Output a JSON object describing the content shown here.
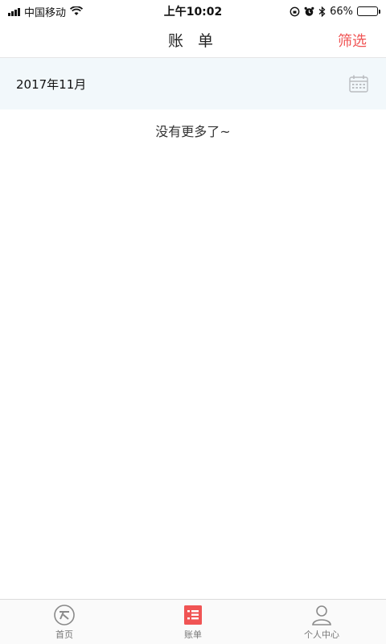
{
  "status_bar": {
    "carrier": "中国移动",
    "time": "上午10:02",
    "battery": "66%",
    "battery_level": 0.66
  },
  "nav": {
    "title": "账 单",
    "filter_label": "筛选"
  },
  "month": {
    "label": "2017年11月"
  },
  "empty_message": "没有更多了~",
  "tabs": [
    {
      "label": "首页",
      "icon": "home-icon"
    },
    {
      "label": "账单",
      "icon": "bill-icon",
      "active": true
    },
    {
      "label": "个人中心",
      "icon": "user-icon"
    }
  ],
  "colors": {
    "accent": "#f05454",
    "month_bg": "#f2f8fb"
  }
}
